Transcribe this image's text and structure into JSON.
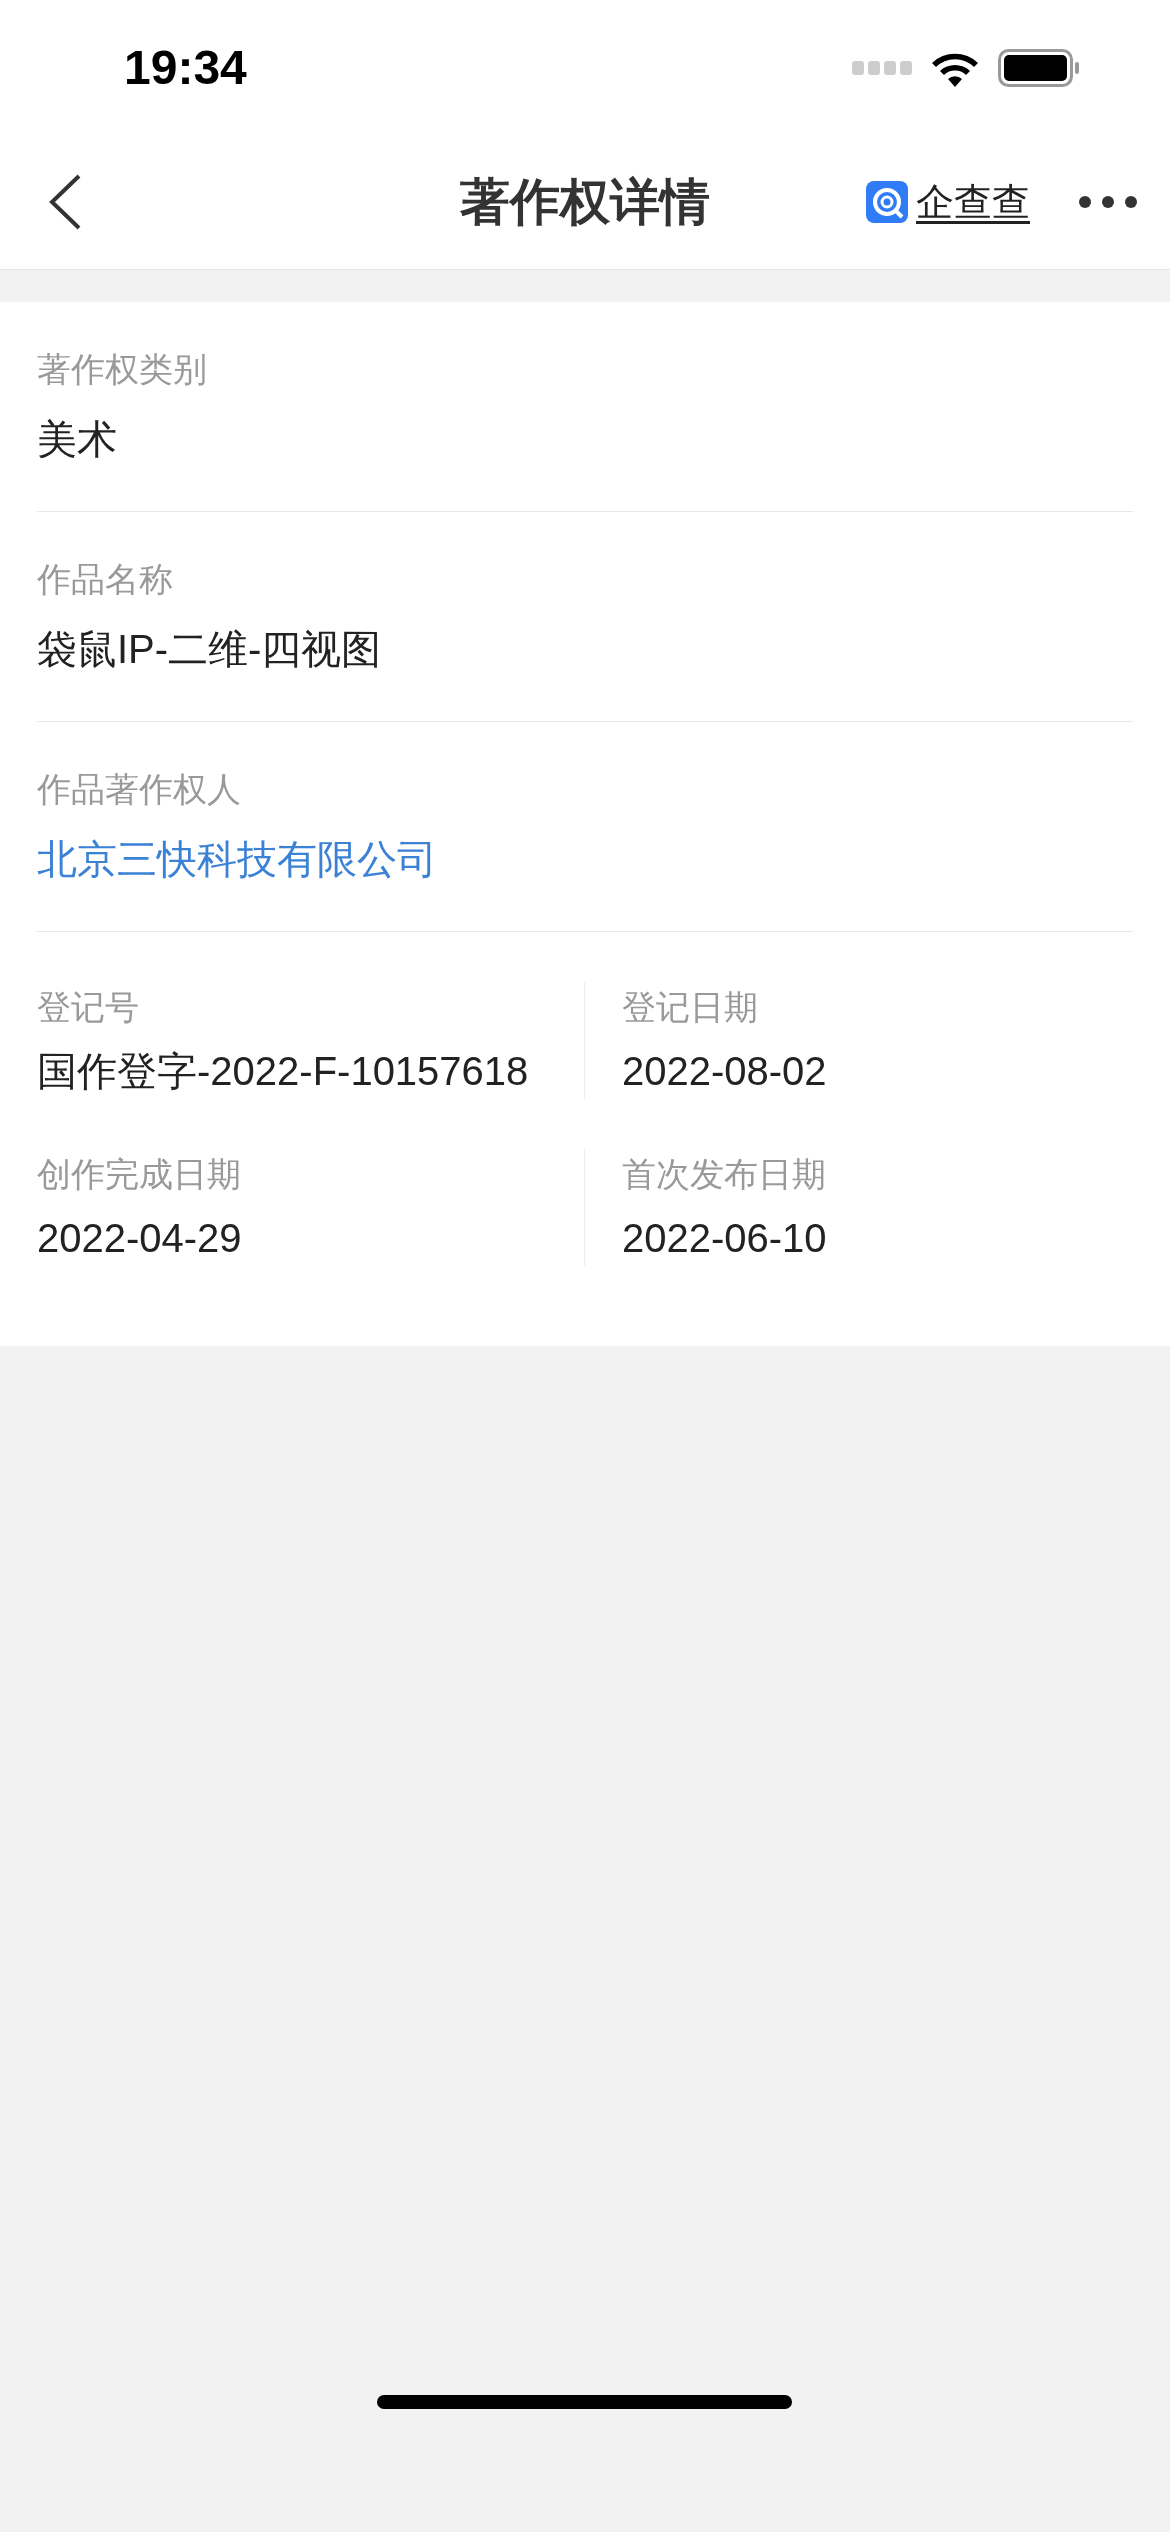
{
  "status_bar": {
    "time": "19:34"
  },
  "nav": {
    "title": "著作权详情",
    "brand": "企查查"
  },
  "fields": [
    {
      "label": "著作权类别",
      "value": "美术",
      "kind": "text"
    },
    {
      "label": "作品名称",
      "value": "袋鼠IP-二维-四视图",
      "kind": "text"
    },
    {
      "label": "作品著作权人",
      "value": "北京三快科技有限公司",
      "kind": "link"
    }
  ],
  "grid": [
    {
      "label": "登记号",
      "value": "国作登字-2022-F-10157618"
    },
    {
      "label": "登记日期",
      "value": "2022-08-02"
    },
    {
      "label": "创作完成日期",
      "value": "2022-04-29"
    },
    {
      "label": "首次发布日期",
      "value": "2022-06-10"
    }
  ]
}
